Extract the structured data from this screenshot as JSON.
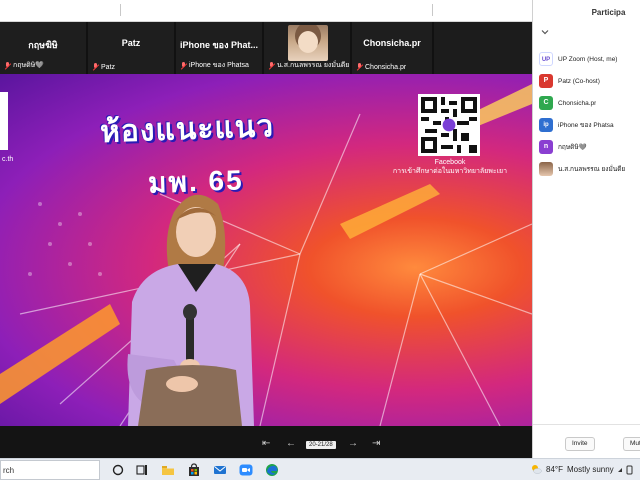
{
  "gallery": {
    "tiles": [
      {
        "big_name": "กฤษฆิษิ",
        "caption": "กฤษดิษิ🩶"
      },
      {
        "big_name": "Patz",
        "caption": "Patz"
      },
      {
        "big_name": "iPhone ของ Phat...",
        "caption": "iPhone ของ Phatsa"
      },
      {
        "big_name": "",
        "caption": "น.ส.กนลพรรณ ยงมั่นดีย"
      },
      {
        "big_name": "Chonsicha.pr",
        "caption": "Chonsicha.pr"
      }
    ]
  },
  "stage": {
    "headline": "ห้องแนะแนว",
    "subline": "มพ. 65",
    "left_text": "c.th",
    "qr_label_1": "Facebook",
    "qr_label_2": "การเข้าศึกษาต่อในมหาวิทยาลัยพะเยา"
  },
  "controls": {
    "pager": "20-21/28"
  },
  "participants": {
    "title": "Participa",
    "items": [
      {
        "avatar_text": "UP",
        "name": "UP Zoom (Host, me)",
        "color": "#ffffff"
      },
      {
        "avatar_text": "P",
        "name": "Patz (Co-host)",
        "color": "#d9382f"
      },
      {
        "avatar_text": "C",
        "name": "Chonsicha.pr",
        "color": "#2fa84f"
      },
      {
        "avatar_text": "ip",
        "name": "iPhone ของ Phatsa",
        "color": "#2f6fd0"
      },
      {
        "avatar_text": "n",
        "name": "กฤษดิษิ🩶",
        "color": "#8a3fd1"
      },
      {
        "avatar_text": "",
        "name": "น.ส.กนลพรรณ ยงมั่นดีย",
        "color": "#c99a7c"
      }
    ],
    "invite_label": "Invite",
    "mute_label": "Mut"
  },
  "taskbar": {
    "search_text": "rch",
    "temperature": "84°F",
    "weather": "Mostly sunny"
  }
}
